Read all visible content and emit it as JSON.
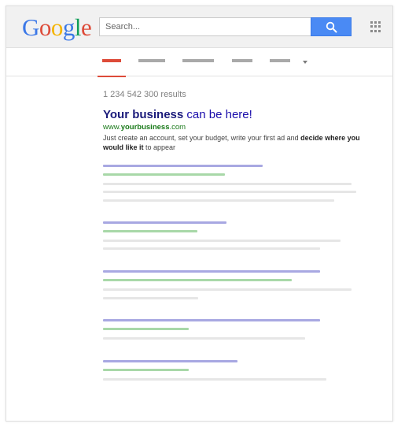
{
  "header": {
    "logo_letters": [
      {
        "char": "G",
        "color": "#3b78e7"
      },
      {
        "char": "o",
        "color": "#dd4b39"
      },
      {
        "char": "o",
        "color": "#f4b400"
      },
      {
        "char": "g",
        "color": "#3b78e7"
      },
      {
        "char": "l",
        "color": "#0f9d58"
      },
      {
        "char": "e",
        "color": "#dd4b39"
      }
    ],
    "search": {
      "placeholder": "Search...",
      "icon": "magnifier-icon",
      "button_color": "#4a8af4"
    },
    "apps_icon": "apps-grid-icon"
  },
  "tabs": {
    "active_color": "#dd4b39",
    "inactive_color": "#a9a9a9",
    "more_icon": "chevron-down-icon"
  },
  "results_count": "1 234 542 300 results",
  "ad": {
    "title_bold": "Your business",
    "title_rest": " can be here!",
    "url_prefix": "www.",
    "url_bold": "yourbusiness",
    "url_suffix": ".com",
    "desc_part1": "Just create an account, set your budget, write your first ad and ",
    "desc_bold": "decide where you would like it",
    "desc_part2": " to appear"
  },
  "colors": {
    "title_placeholder": "#a8a8e2",
    "url_placeholder": "#a8d8a8",
    "snippet_placeholder": "#e6e6e6"
  }
}
